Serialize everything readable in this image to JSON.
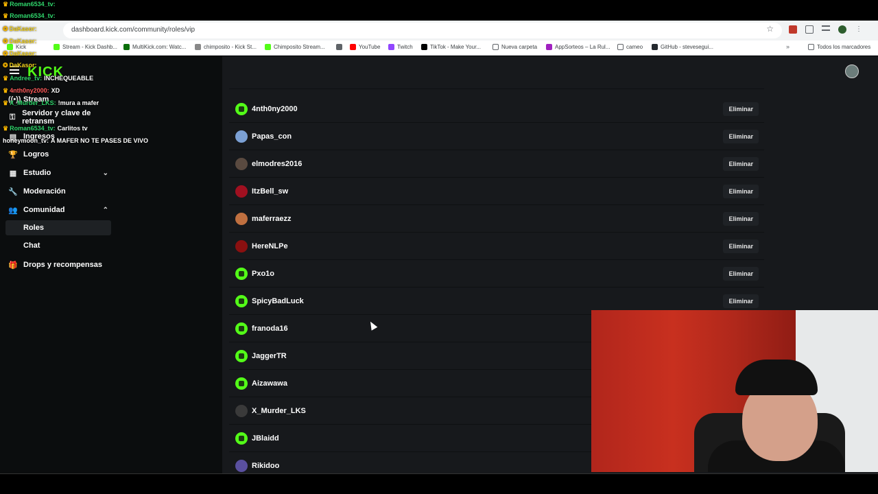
{
  "browser": {
    "url": "dashboard.kick.com/community/roles/vip",
    "bookmarks": [
      {
        "label": "Kick",
        "color": "#53fc18"
      },
      {
        "label": "Stream - Kick Dashb...",
        "color": "#53fc18"
      },
      {
        "label": "MultiKick.com: Watc...",
        "color": "#0a6e0a"
      },
      {
        "label": "chimposito - Kick St...",
        "color": "#888888"
      },
      {
        "label": "Chimposito Stream...",
        "color": "#53fc18"
      },
      {
        "label": "",
        "color": "#5f6368"
      },
      {
        "label": "YouTube",
        "color": "#ff0000"
      },
      {
        "label": "Twitch",
        "color": "#9146ff"
      },
      {
        "label": "TikTok - Make Your...",
        "color": "#000000"
      },
      {
        "label": "Nueva carpeta",
        "color": "folder"
      },
      {
        "label": "AppSorteos – La Rul...",
        "color": "#a020c0"
      },
      {
        "label": "cameo",
        "color": "folder"
      },
      {
        "label": "GitHub - stevesegui...",
        "color": "#24292e"
      }
    ],
    "more_label": "»",
    "all_bookmarks": "Todos los marcadores"
  },
  "sidebar": {
    "logo": "KICK",
    "items": [
      {
        "label": "Stream",
        "icon": "broadcast-icon"
      },
      {
        "label": "Servidor y clave de retransm",
        "icon": "key-icon"
      },
      {
        "label": "Ingresos",
        "icon": "money-icon"
      },
      {
        "label": "Logros",
        "icon": "trophy-icon"
      },
      {
        "label": "Estudio",
        "icon": "studio-icon",
        "chevron": "⌄"
      },
      {
        "label": "Moderación",
        "icon": "wrench-icon"
      },
      {
        "label": "Comunidad",
        "icon": "users-icon",
        "chevron": "⌃"
      },
      {
        "label": "Drops y recompensas",
        "icon": "gift-icon"
      }
    ],
    "sub_items": [
      {
        "label": "Roles",
        "active": true
      },
      {
        "label": "Chat",
        "active": false
      }
    ]
  },
  "vip_list": {
    "delete_label": "Eliminar",
    "rows": [
      {
        "name": "4nth0ny2000",
        "avatar": "kick",
        "has_button": true
      },
      {
        "name": "Papas_con",
        "avatar": "#7ba0d4",
        "has_button": true
      },
      {
        "name": "elmodres2016",
        "avatar": "#5a4a40",
        "has_button": true
      },
      {
        "name": "ItzBell_sw",
        "avatar": "#a01020",
        "has_button": true
      },
      {
        "name": "maferraezz",
        "avatar": "#c07040",
        "has_button": true
      },
      {
        "name": "HereNLPe",
        "avatar": "#8a1010",
        "has_button": true
      },
      {
        "name": "Pxo1o",
        "avatar": "kick",
        "has_button": true
      },
      {
        "name": "SpicyBadLuck",
        "avatar": "kick",
        "has_button": true
      },
      {
        "name": "franoda16",
        "avatar": "kick",
        "has_button": false
      },
      {
        "name": "JaggerTR",
        "avatar": "kick",
        "has_button": false
      },
      {
        "name": "Aizawawa",
        "avatar": "kick",
        "has_button": false
      },
      {
        "name": "X_Murder_LKS",
        "avatar": "#3a3a3a",
        "has_button": false
      },
      {
        "name": "JBlaidd",
        "avatar": "kick",
        "has_button": false
      },
      {
        "name": "Rikidoo",
        "avatar": "#5a50a0",
        "has_button": false
      }
    ]
  },
  "chat_overlay": [
    {
      "user": "Roman6534_tv:",
      "msg": "",
      "user_color": "green",
      "badge": "crown"
    },
    {
      "user": "Roman6534_tv:",
      "msg": "",
      "user_color": "green",
      "badge": "crown"
    },
    {
      "user": "DaKasor:",
      "msg": "",
      "user_color": "yellow",
      "badge": "gift"
    },
    {
      "user": "DaKasor:",
      "msg": "",
      "user_color": "yellow",
      "badge": "gift"
    },
    {
      "user": "DaKasor:",
      "msg": "",
      "user_color": "yellow",
      "badge": "gift"
    },
    {
      "user": "DaKasor:",
      "msg": "",
      "user_color": "yellow",
      "badge": "gift"
    },
    {
      "user": "Andree_tv:",
      "msg": "INCHEQUEABLE",
      "user_color": "green",
      "badge": "crown"
    },
    {
      "user": "4nth0ny2000:",
      "msg": "XD",
      "user_color": "red",
      "badge": "crown"
    },
    {
      "user": "X_Murder_LKS:",
      "msg": "!mura a mafer",
      "user_color": "green",
      "badge": "crown"
    },
    {
      "user": "Roman6534_tv:",
      "msg": "Carlitos tv",
      "user_color": "green",
      "badge": "crown"
    },
    {
      "user": "honeymoon_tv:",
      "msg": "A MAFER NO TE PASES DE VIVO",
      "user_color": "white",
      "badge": ""
    }
  ]
}
